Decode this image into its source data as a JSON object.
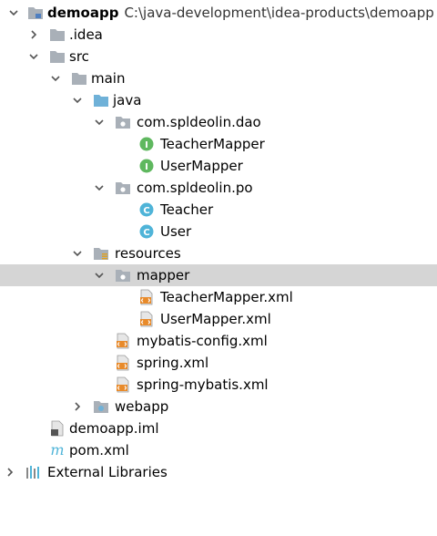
{
  "tree": {
    "root": {
      "label": "demoapp",
      "path": "C:\\java-development\\idea-products\\demoapp"
    },
    "idea": {
      "label": ".idea"
    },
    "src": {
      "label": "src"
    },
    "main": {
      "label": "main"
    },
    "java": {
      "label": "java"
    },
    "pkg_dao": {
      "label": "com.spldeolin.dao"
    },
    "teacher_mapper": {
      "label": "TeacherMapper",
      "badge": "I"
    },
    "user_mapper": {
      "label": "UserMapper",
      "badge": "I"
    },
    "pkg_po": {
      "label": "com.spldeolin.po"
    },
    "teacher": {
      "label": "Teacher",
      "badge": "C"
    },
    "user": {
      "label": "User",
      "badge": "C"
    },
    "resources": {
      "label": "resources"
    },
    "mapper": {
      "label": "mapper"
    },
    "teacher_mapper_xml": {
      "label": "TeacherMapper.xml"
    },
    "user_mapper_xml": {
      "label": "UserMapper.xml"
    },
    "mybatis_config_xml": {
      "label": "mybatis-config.xml"
    },
    "spring_xml": {
      "label": "spring.xml"
    },
    "spring_mybatis_xml": {
      "label": "spring-mybatis.xml"
    },
    "webapp": {
      "label": "webapp"
    },
    "demoapp_iml": {
      "label": "demoapp.iml"
    },
    "pom_xml": {
      "label": "pom.xml",
      "badge": "m"
    },
    "external_libraries": {
      "label": "External Libraries"
    }
  },
  "colors": {
    "folder": "#a9b0b8",
    "source_folder": "#6fb1d8",
    "interface": "#5fb85f",
    "class": "#4fb4d8",
    "xml": "#e88a2a",
    "selection": "#d5d5d5"
  }
}
